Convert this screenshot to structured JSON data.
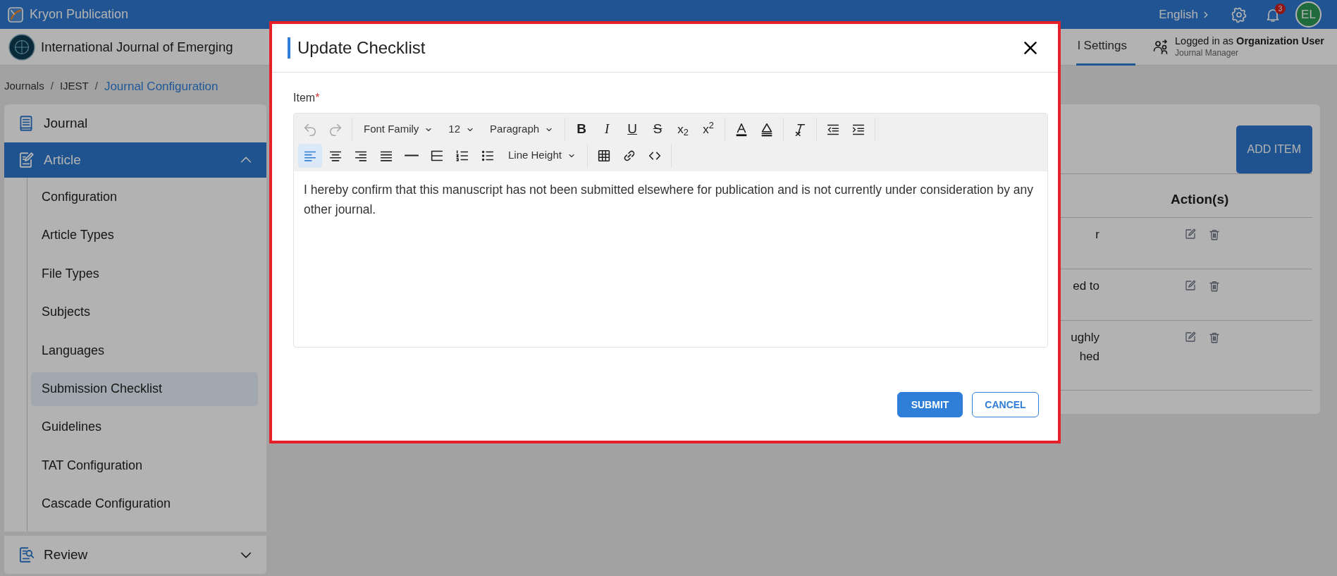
{
  "app_bar": {
    "title": "Kryon Publication",
    "language": "English",
    "notification_count": "3",
    "avatar_initials": "EL"
  },
  "journal_bar": {
    "journal_name": "International Journal of Emerging",
    "tabs": [
      {
        "label": "l Settings",
        "selected": true
      }
    ],
    "user_line": "Logged in as **Organization User**",
    "user_role": "Journal Manager"
  },
  "breadcrumb_separator": "/",
  "breadcrumb": [
    {
      "label": "Journals",
      "current": false
    },
    {
      "label": "IJEST",
      "current": false
    },
    {
      "label": "Journal Configuration",
      "current": true
    }
  ],
  "sidebar": {
    "items": [
      {
        "label": "Journal",
        "kind": "page",
        "selected": false
      },
      {
        "label": "Article",
        "kind": "group",
        "selected": true,
        "expanded": true,
        "children": [
          {
            "label": "Configuration",
            "selected": false
          },
          {
            "label": "Article Types",
            "selected": false
          },
          {
            "label": "File Types",
            "selected": false
          },
          {
            "label": "Subjects",
            "selected": false
          },
          {
            "label": "Languages",
            "selected": false
          },
          {
            "label": "Submission Checklist",
            "selected": true
          },
          {
            "label": "Guidelines",
            "selected": false
          },
          {
            "label": "TAT Configuration",
            "selected": false
          },
          {
            "label": "Cascade Configuration",
            "selected": false
          }
        ]
      },
      {
        "label": "Review",
        "kind": "group",
        "selected": false,
        "expanded": false
      }
    ]
  },
  "checklist_panel": {
    "add_button": "ADD ITEM",
    "columns": [
      {
        "label": "Action(s)"
      }
    ],
    "rows": [
      {
        "column_1": [
          "r"
        ]
      },
      {
        "column_1": [
          "ed to"
        ]
      },
      {
        "column_1": [
          "ughly",
          "hed"
        ]
      }
    ]
  },
  "modal": {
    "title": "Update Checklist",
    "field": {
      "label": "Item",
      "required": true,
      "required_mark": "*",
      "toolbar": [
        [
          [
            {
              "kind": "undo",
              "disabled": true,
              "active": false
            },
            {
              "kind": "redo",
              "disabled": true,
              "active": false
            }
          ],
          [
            {
              "kind": "dropdown",
              "label": "Font Family"
            },
            {
              "kind": "dropdown",
              "label": "12"
            },
            {
              "kind": "dropdown",
              "label": "Paragraph"
            }
          ],
          [
            {
              "kind": "bold",
              "label": "B",
              "disabled": false,
              "active": false
            },
            {
              "kind": "italic",
              "label": "I",
              "disabled": false,
              "active": false
            },
            {
              "kind": "underline",
              "label": "U",
              "disabled": false,
              "active": false
            },
            {
              "kind": "strike",
              "label": "S",
              "disabled": false,
              "active": false
            },
            {
              "kind": "subscript",
              "label": "x$_{2}$",
              "disabled": false,
              "active": false
            },
            {
              "kind": "superscript",
              "label": "x$^{2}$",
              "disabled": false,
              "active": false
            }
          ],
          [
            {
              "kind": "textcolor",
              "disabled": false,
              "active": false
            },
            {
              "kind": "highlight",
              "disabled": false,
              "active": false
            }
          ],
          [
            {
              "kind": "clearformat",
              "disabled": false,
              "active": false
            }
          ],
          [
            {
              "kind": "outdent",
              "disabled": false,
              "active": false
            },
            {
              "kind": "indent",
              "disabled": false,
              "active": false
            }
          ]
        ],
        [
          [
            {
              "kind": "alignleft",
              "disabled": false,
              "active": true
            },
            {
              "kind": "aligncenter",
              "disabled": false,
              "active": false
            },
            {
              "kind": "alignright",
              "disabled": false,
              "active": false
            },
            {
              "kind": "justify",
              "disabled": false,
              "active": false
            },
            {
              "kind": "hr",
              "disabled": false,
              "active": false
            },
            {
              "kind": "block",
              "disabled": false,
              "active": false
            },
            {
              "kind": "ol",
              "disabled": false,
              "active": false
            },
            {
              "kind": "ul",
              "disabled": false,
              "active": false
            },
            {
              "kind": "dropdown",
              "label": "Line Height"
            }
          ],
          [
            {
              "kind": "table",
              "disabled": false,
              "active": false
            },
            {
              "kind": "link",
              "disabled": false,
              "active": false
            },
            {
              "kind": "code",
              "disabled": false,
              "active": false
            }
          ]
        ]
      ],
      "value": "I hereby confirm that this manuscript has not been submitted elsewhere for publication and is not currently under consideration by any other journal."
    },
    "buttons": [
      {
        "label": "SUBMIT",
        "kind": "primary"
      },
      {
        "label": "CANCEL",
        "kind": "outline"
      }
    ]
  }
}
